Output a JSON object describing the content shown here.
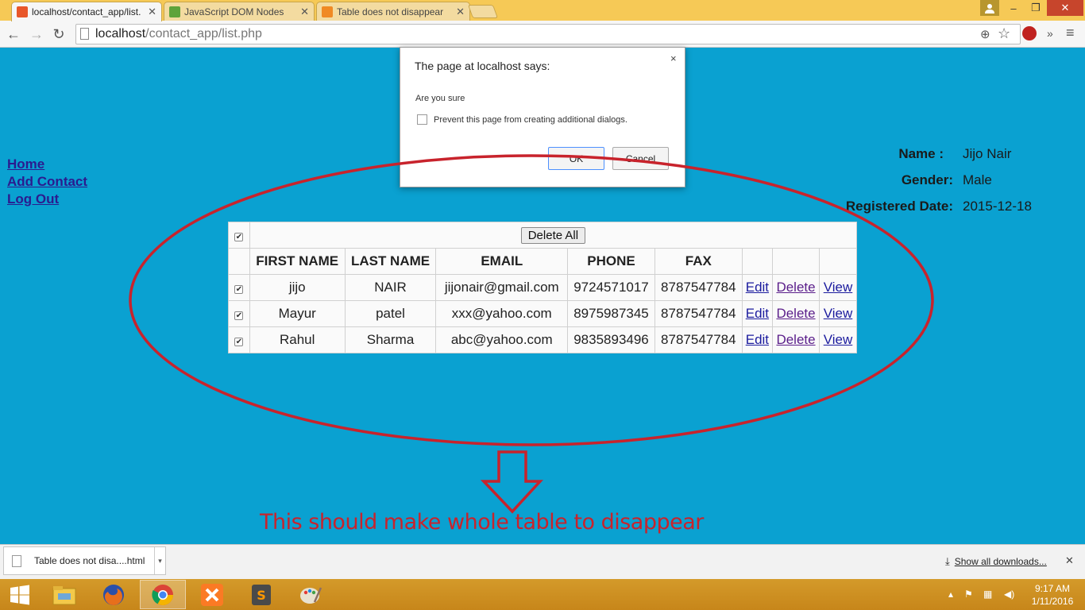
{
  "browser": {
    "tabs": [
      {
        "label": "localhost/contact_app/list.",
        "fav_color": "#e8572a",
        "active": true
      },
      {
        "label": "JavaScript DOM Nodes",
        "fav_color": "#5fa33b",
        "active": false
      },
      {
        "label": "Table does not disappear",
        "fav_color": "#f08a24",
        "active": false
      }
    ],
    "url_host": "localhost",
    "url_path": "/contact_app/list.php",
    "window_buttons": {
      "minimize": "–",
      "restore": "❐",
      "close": "✕"
    },
    "user_icon": "user-icon"
  },
  "sidebar": {
    "links": [
      "Home",
      "Add Contact",
      "Log Out "
    ]
  },
  "user_info": {
    "name_label": "Name :",
    "name_value": "Jijo Nair",
    "gender_label": "Gender:",
    "gender_value": "Male",
    "date_label": "Registered Date:",
    "date_value": "2015-12-18"
  },
  "table": {
    "delete_all_label": "Delete All",
    "headers": [
      "FIRST NAME",
      "LAST NAME",
      "EMAIL",
      "PHONE",
      "FAX"
    ],
    "rows": [
      {
        "first": "jijo",
        "last": "NAIR",
        "email": "jijonair@gmail.com",
        "phone": "9724571017",
        "fax": "8787547784",
        "checked": true
      },
      {
        "first": "Mayur",
        "last": "patel",
        "email": "xxx@yahoo.com",
        "phone": "8975987345",
        "fax": "8787547784",
        "checked": true
      },
      {
        "first": "Rahul",
        "last": "Sharma",
        "email": "abc@yahoo.com",
        "phone": "9835893496",
        "fax": "8787547784",
        "checked": true
      }
    ],
    "action_labels": {
      "edit": "Edit",
      "delete": "Delete",
      "view": "View"
    },
    "select_all_checked": true
  },
  "dialog": {
    "title": "The page at localhost says:",
    "close": "×",
    "message": "Are you sure",
    "prevent_label": "Prevent this page from creating additional dialogs.",
    "ok_label": "OK",
    "cancel_label": "Cancel"
  },
  "annotation": {
    "text": "This should make whole table to disappear",
    "color": "#c8232c"
  },
  "downloads": {
    "file_label": "Table does not disa....html",
    "show_all": "Show all downloads...",
    "close": "✕"
  },
  "taskbar": {
    "time": "9:17 AM",
    "date": "1/11/2016",
    "apps": [
      "windows-start-icon",
      "file-explorer-icon",
      "firefox-icon",
      "chrome-icon",
      "xampp-icon",
      "sublime-text-icon",
      "paint-icon"
    ]
  },
  "colors": {
    "page_bg": "#0aa1d1",
    "titlebar": "#f6c956",
    "link": "#2b1b8f"
  }
}
